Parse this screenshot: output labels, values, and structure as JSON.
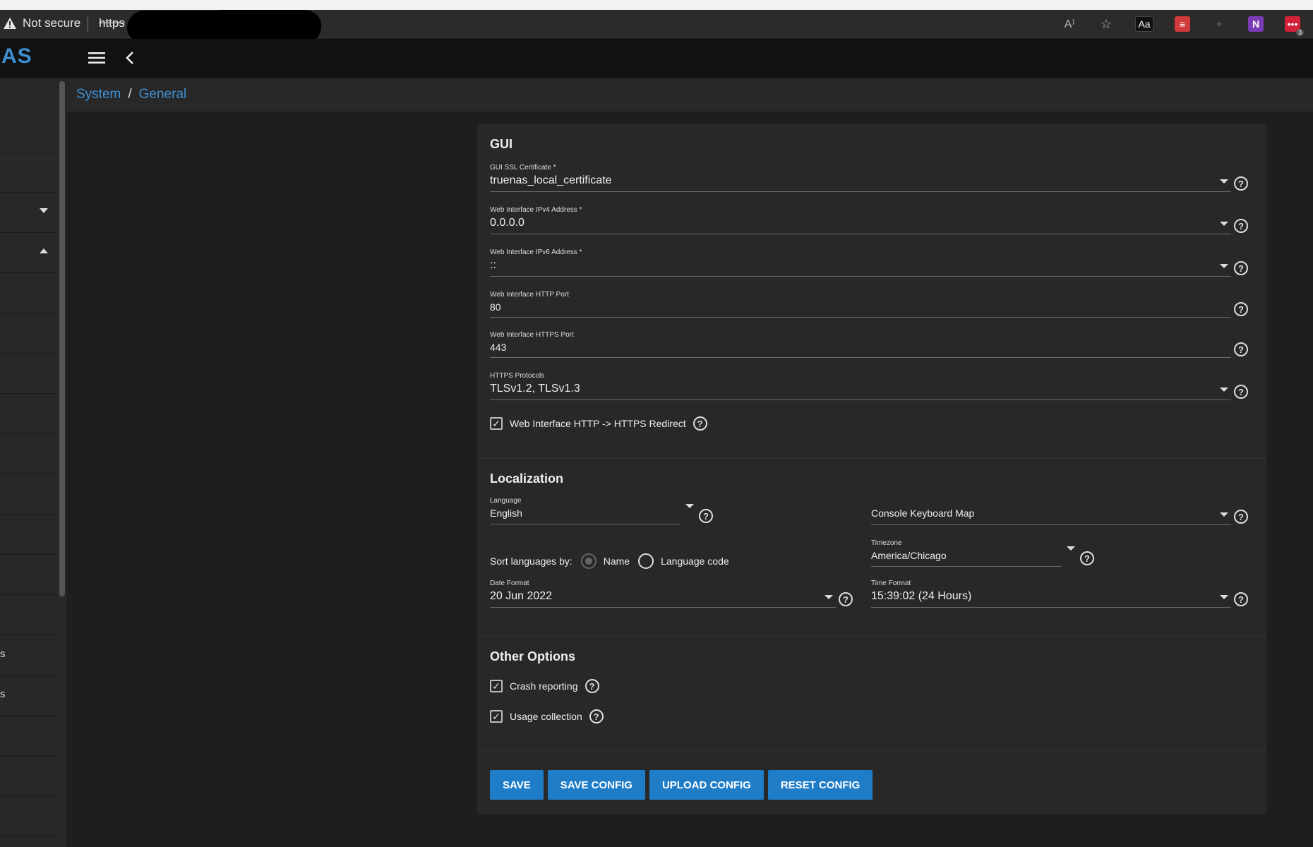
{
  "browser": {
    "security_label": "Not secure",
    "url_prefix": "https"
  },
  "app": {
    "logo": "AS"
  },
  "breadcrumb": {
    "items": [
      "System",
      "General"
    ],
    "separator": "/"
  },
  "sidebar": {
    "partial_labels": [
      "s",
      "s"
    ]
  },
  "gui": {
    "title": "GUI",
    "ssl_cert": {
      "label": "GUI SSL Certificate *",
      "value": "truenas_local_certificate"
    },
    "ipv4": {
      "label": "Web Interface IPv4 Address *",
      "value": "0.0.0.0"
    },
    "ipv6": {
      "label": "Web Interface IPv6 Address *",
      "value": "::"
    },
    "http_port": {
      "label": "Web Interface HTTP Port",
      "value": "80"
    },
    "https_port": {
      "label": "Web Interface HTTPS Port",
      "value": "443"
    },
    "https_protocols": {
      "label": "HTTPS Protocols",
      "value": "TLSv1.2, TLSv1.3"
    },
    "redirect": {
      "label": "Web Interface HTTP -> HTTPS Redirect",
      "checked": true
    }
  },
  "localization": {
    "title": "Localization",
    "language": {
      "label": "Language",
      "value": "English"
    },
    "keyboard_map": {
      "placeholder": "Console Keyboard Map"
    },
    "sort_by": {
      "label": "Sort languages by:",
      "options": [
        "Name",
        "Language code"
      ],
      "selected": "Name"
    },
    "timezone": {
      "label": "Timezone",
      "value": "America/Chicago"
    },
    "date_format": {
      "label": "Date Format",
      "value": "20 Jun 2022"
    },
    "time_format": {
      "label": "Time Format",
      "value": "15:39:02 (24 Hours)"
    }
  },
  "other": {
    "title": "Other Options",
    "crash_reporting": {
      "label": "Crash reporting",
      "checked": true
    },
    "usage_collection": {
      "label": "Usage collection",
      "checked": true
    }
  },
  "actions": {
    "save": "SAVE",
    "save_config": "SAVE CONFIG",
    "upload_config": "UPLOAD CONFIG",
    "reset_config": "RESET CONFIG"
  },
  "help_glyph": "?",
  "check_glyph": "✓",
  "colors": {
    "accent": "#3d8fd1",
    "button": "#1f7dc8",
    "background": "#1e1e1e",
    "card": "#282828"
  }
}
